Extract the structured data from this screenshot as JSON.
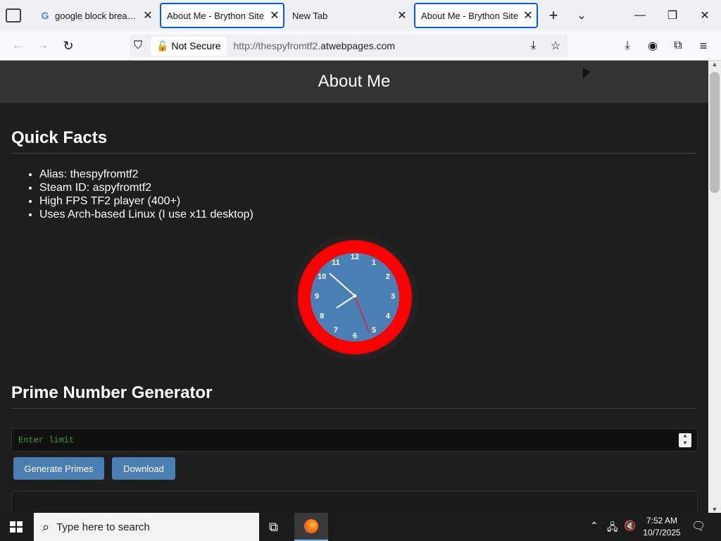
{
  "tabs": [
    {
      "title": "google block breaker -"
    },
    {
      "title": "About Me - Brython Site"
    },
    {
      "title": "New Tab"
    },
    {
      "title": "About Me - Brython Site"
    }
  ],
  "nav": {
    "security": "Not Secure",
    "url_prefix": "http://thespyfromtf2.",
    "url_domain": "atwebpages.com"
  },
  "page": {
    "header": "About Me",
    "facts_title": "Quick Facts",
    "facts": [
      "Alias: thespyfromtf2",
      "Steam ID: aspyfromtf2",
      "High FPS TF2 player (400+)",
      "Uses Arch-based Linux (I use x11 desktop)"
    ],
    "clock_numbers": [
      "12",
      "1",
      "2",
      "3",
      "4",
      "5",
      "6",
      "7",
      "8",
      "9",
      "10",
      "11"
    ],
    "prime_title": "Prime Number Generator",
    "limit_placeholder": "Enter limit",
    "generate_label": "Generate Primes",
    "download_label": "Download"
  },
  "taskbar": {
    "search_placeholder": "Type here to search",
    "time": "7:52 AM",
    "date": "10/7/2025"
  },
  "colors": {
    "accent": "#0061e0",
    "button": "#4a7fb5",
    "clock_ring": "#ff0000"
  }
}
